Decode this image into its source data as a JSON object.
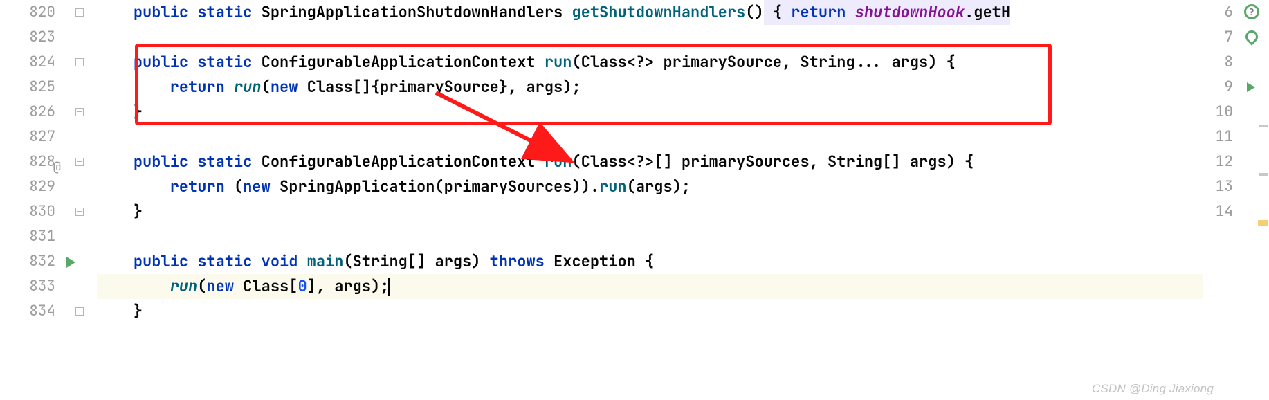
{
  "left_line_numbers": [
    "820",
    "823",
    "824",
    "825",
    "826",
    "827",
    "828",
    "829",
    "830",
    "831",
    "832",
    "833",
    "834"
  ],
  "right_line_numbers": [
    "6",
    "7",
    "8",
    "9",
    "10",
    "11",
    "12",
    "13",
    "14",
    "",
    "",
    "",
    "",
    "",
    "",
    ""
  ],
  "code": {
    "l820": {
      "kw1": "public",
      "kw2": "static",
      "type": "SpringApplicationShutdownHandlers",
      "mth": "getShutdownHandlers",
      "parens": "()",
      "brace": " { ",
      "kw3": "return",
      "fld": "shutdownHook",
      "tail": ".getH"
    },
    "l823": {
      "blank": ""
    },
    "l824": {
      "kw1": "public",
      "kw2": "static",
      "type": "ConfigurableApplicationContext",
      "mth": "run",
      "sig": "(Class<?> primarySource, String... args) {"
    },
    "l825": {
      "kw": "return",
      "mth": "run",
      "open": "(",
      "kw2": "new",
      "rest": " Class[]{primarySource}, args);"
    },
    "l826": {
      "brace": "}"
    },
    "l827": {
      "blank": ""
    },
    "l828": {
      "kw1": "public",
      "kw2": "static",
      "type": "ConfigurableApplicationContext",
      "mth": "run",
      "sig": "(Class<?>[] primarySources, String[] args) {"
    },
    "l829": {
      "kw": "return",
      "open": " (",
      "kw2": "new",
      "rest": " SpringApplication(primarySources)).",
      "mth": "run",
      "tail": "(args);"
    },
    "l830": {
      "brace": "}"
    },
    "l831": {
      "blank": ""
    },
    "l832": {
      "kw1": "public",
      "kw2": "static",
      "kw3": "void",
      "mth": "main",
      "sig": "(String[] args) ",
      "kw4": "throws",
      "exc": " Exception {"
    },
    "l833": {
      "mth": "run",
      "open": "(",
      "kw": "new",
      "sp": " Class[",
      "num": "0",
      "rest": "], args);"
    },
    "l834": {
      "brace": "}"
    }
  },
  "at_marker": "@",
  "watermark": "CSDN @Ding Jiaxiong"
}
